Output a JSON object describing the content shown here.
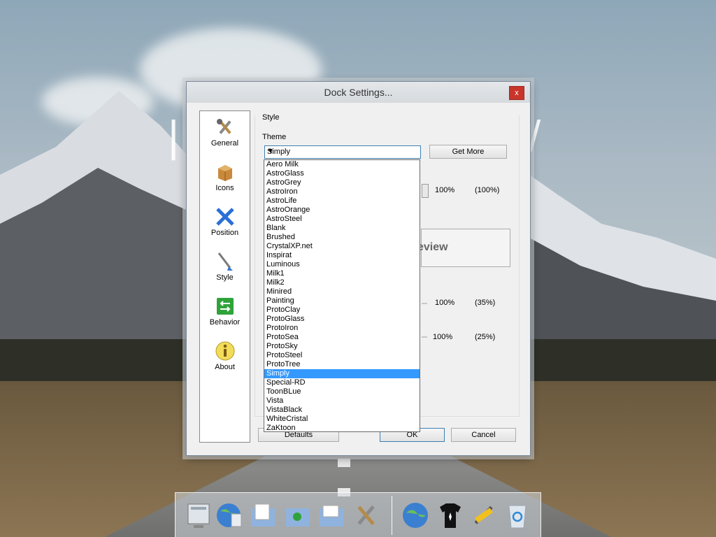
{
  "dialog": {
    "title": "Dock Settings...",
    "close_glyph": "x"
  },
  "nav": [
    {
      "label": "General",
      "icon": "tools-icon"
    },
    {
      "label": "Icons",
      "icon": "box-icon"
    },
    {
      "label": "Position",
      "icon": "arrows-icon"
    },
    {
      "label": "Style",
      "icon": "brush-icon"
    },
    {
      "label": "Behavior",
      "icon": "behavior-icon"
    },
    {
      "label": "About",
      "icon": "info-icon"
    }
  ],
  "style": {
    "group_title": "Style",
    "theme_label": "Theme",
    "theme_value": "Simply",
    "get_more": "Get More",
    "preview_text": "eview",
    "row1_value": "100%",
    "row1_paren": "(100%)",
    "row2_value": "100%",
    "row2_paren": "(35%)",
    "row3_value": "100%",
    "row3_paren": "(25%)"
  },
  "buttons": {
    "defaults": "Defaults",
    "ok": "OK",
    "cancel": "Cancel"
  },
  "themes": [
    "Aero Milk",
    "AstroGlass",
    "AstroGrey",
    "AstroIron",
    "AstroLife",
    "AstroOrange",
    "AstroSteel",
    "Blank",
    "Brushed",
    "CrystalXP.net",
    "Inspirat",
    "Luminous",
    "Milk1",
    "Milk2",
    "Minired",
    "Painting",
    "ProtoClay",
    "ProtoGlass",
    "ProtoIron",
    "ProtoSea",
    "ProtoSky",
    "ProtoSteel",
    "ProtoTree",
    "Simply",
    "Special-RD",
    "ToonBLue",
    "Vista",
    "VistaBlack",
    "WhiteCristal",
    "ZaKtoon"
  ],
  "selected_theme": "Simply",
  "dock": {
    "icons": [
      "monitor-icon",
      "globe-icon",
      "documents-icon",
      "music-folder-icon",
      "pictures-folder-icon",
      "tools-icon",
      "internet-icon",
      "tshirt-icon",
      "hammer-icon",
      "recycle-bin-icon"
    ]
  },
  "colors": {
    "selection": "#3399ff",
    "close": "#c8352b"
  }
}
